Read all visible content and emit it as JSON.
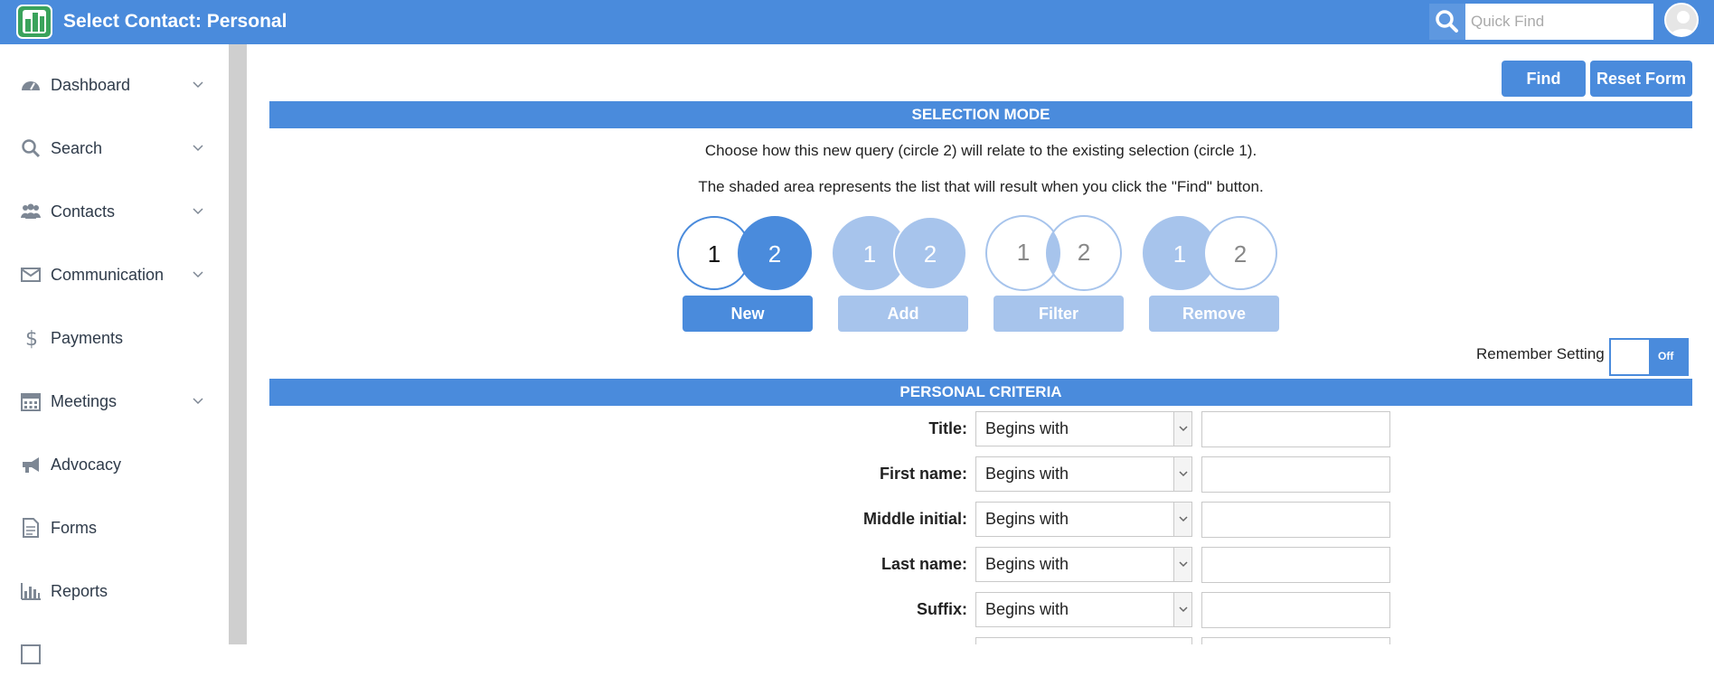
{
  "header": {
    "title": "Select Contact: Personal",
    "quick_find_placeholder": "Quick Find",
    "brand_color": "#4a8bdc"
  },
  "sidebar": {
    "items": [
      {
        "label": "Dashboard",
        "icon": "dashboard-icon",
        "has_chevron": true
      },
      {
        "label": "Search",
        "icon": "search-icon",
        "has_chevron": true
      },
      {
        "label": "Contacts",
        "icon": "contacts-icon",
        "has_chevron": true
      },
      {
        "label": "Communication",
        "icon": "envelope-icon",
        "has_chevron": true
      },
      {
        "label": "Payments",
        "icon": "dollar-icon",
        "has_chevron": false
      },
      {
        "label": "Meetings",
        "icon": "calendar-icon",
        "has_chevron": true
      },
      {
        "label": "Advocacy",
        "icon": "megaphone-icon",
        "has_chevron": false
      },
      {
        "label": "Forms",
        "icon": "document-icon",
        "has_chevron": false
      },
      {
        "label": "Reports",
        "icon": "bar-chart-icon",
        "has_chevron": false
      }
    ]
  },
  "toolbar": {
    "find_label": "Find",
    "reset_label": "Reset Form"
  },
  "selection_mode": {
    "header": "SELECTION MODE",
    "instruction_1": "Choose how this new query (circle 2) will relate to the existing selection (circle 1).",
    "instruction_2": "The shaded area represents the list that will result when you click the \"Find\" button.",
    "modes": [
      {
        "label": "New",
        "circle_1": "1",
        "circle_2": "2",
        "selected": true
      },
      {
        "label": "Add",
        "circle_1": "1",
        "circle_2": "2",
        "selected": false
      },
      {
        "label": "Filter",
        "circle_1": "1",
        "circle_2": "2",
        "selected": false
      },
      {
        "label": "Remove",
        "circle_1": "1",
        "circle_2": "2",
        "selected": false
      }
    ],
    "remember_label": "Remember Setting",
    "toggle_state": "Off"
  },
  "criteria": {
    "header": "PERSONAL CRITERIA",
    "fields": [
      {
        "label": "Title:",
        "operator": "Begins with",
        "value": ""
      },
      {
        "label": "First name:",
        "operator": "Begins with",
        "value": ""
      },
      {
        "label": "Middle initial:",
        "operator": "Begins with",
        "value": ""
      },
      {
        "label": "Last name:",
        "operator": "Begins with",
        "value": ""
      },
      {
        "label": "Suffix:",
        "operator": "Begins with",
        "value": ""
      }
    ]
  }
}
